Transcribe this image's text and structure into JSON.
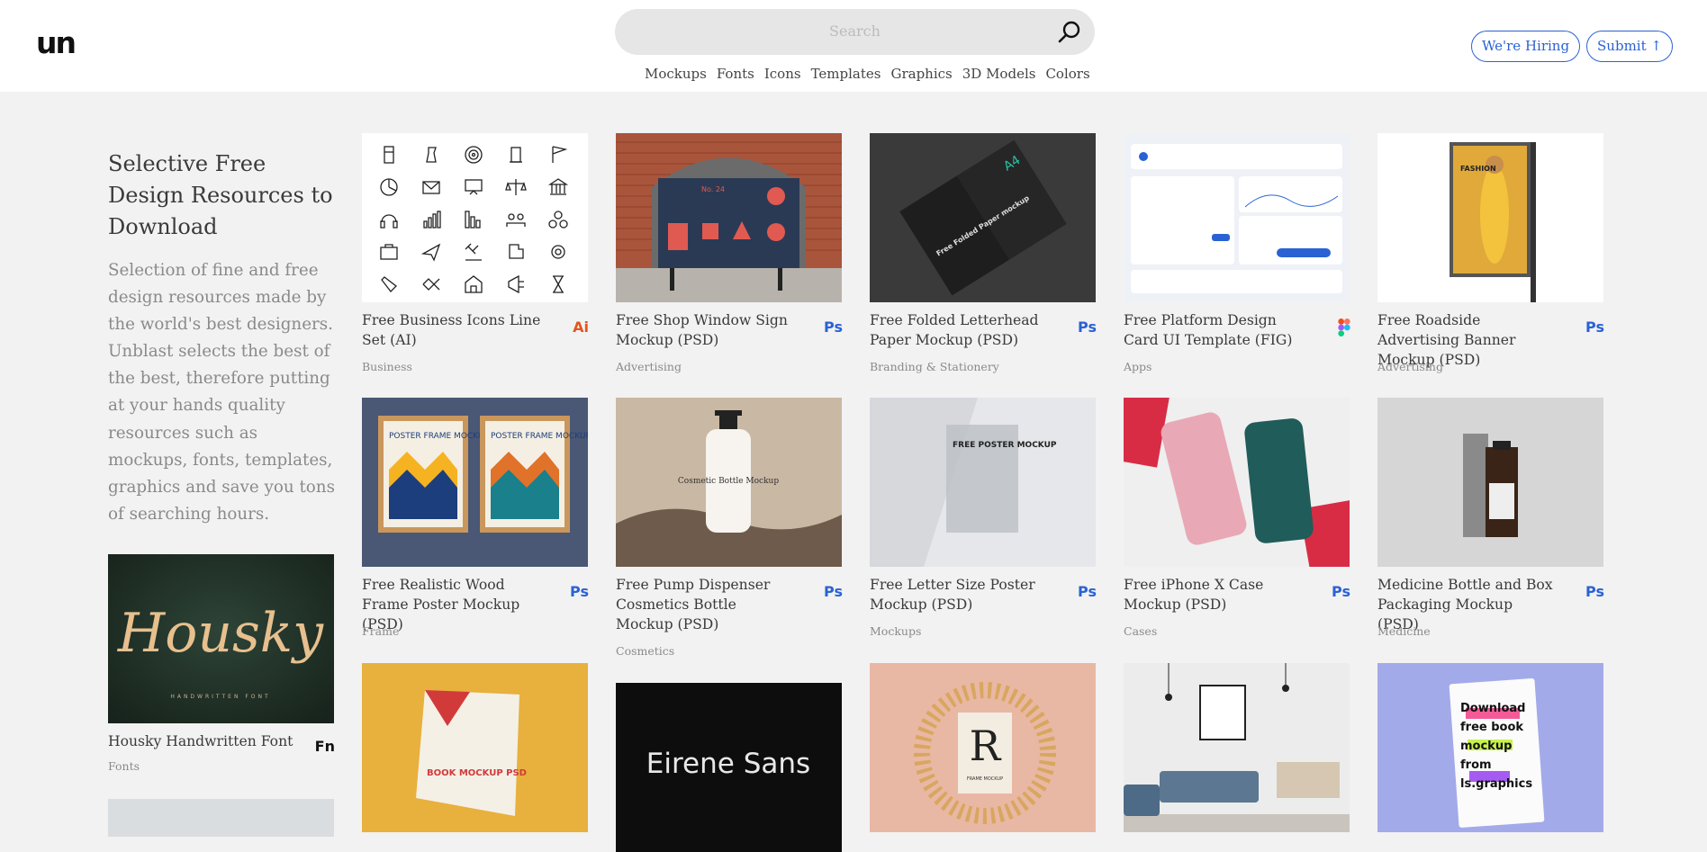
{
  "header": {
    "search_placeholder": "Search",
    "nav": [
      "Mockups",
      "Fonts",
      "Icons",
      "Templates",
      "Graphics",
      "3D Models",
      "Colors"
    ],
    "hiring_label": "We're Hiring",
    "submit_label": "Submit ↑"
  },
  "logo_text": "un",
  "sidebar": {
    "title": "Selective Free Design Resources to Download",
    "description": "Selection of fine and free design resources made by the world's best designers. Unblast selects the best of the best, therefore putting at your hands quality resources such as mockups, fonts, templates, graphics and save you tons of searching hours.",
    "featured": {
      "title": "Housky Handwritten Font",
      "category": "Fonts",
      "badge": "Fn",
      "thumb_text": "Housky",
      "thumb_sub": "HANDWRITTEN FONT"
    }
  },
  "cards": [
    {
      "title": "Free Business Icons Line Set (AI)",
      "category": "Business",
      "badge": "Ai"
    },
    {
      "title": "Free Shop Window Sign Mockup (PSD)",
      "category": "Advertising",
      "badge": "Ps"
    },
    {
      "title": "Free Folded Letterhead Paper Mockup (PSD)",
      "category": "Branding & Stationery",
      "badge": "Ps"
    },
    {
      "title": "Free Platform Design Card UI Template (FIG)",
      "category": "Apps",
      "badge": "figma"
    },
    {
      "title": "Free Roadside Advertising Banner Mockup (PSD)",
      "category": "Advertising",
      "badge": "Ps"
    },
    {
      "title": "Free Realistic Wood Frame Poster Mockup (PSD)",
      "category": "Frame",
      "badge": "Ps"
    },
    {
      "title": "Free Pump Dispenser Cosmetics Bottle Mockup (PSD)",
      "category": "Cosmetics",
      "badge": "Ps"
    },
    {
      "title": "Free Letter Size Poster Mockup (PSD)",
      "category": "Mockups",
      "badge": "Ps"
    },
    {
      "title": "Free iPhone X Case Mockup (PSD)",
      "category": "Cases",
      "badge": "Ps"
    },
    {
      "title": "Medicine Bottle and Box Packaging Mockup (PSD)",
      "category": "Medicine",
      "badge": "Ps"
    }
  ],
  "thumb_text": {
    "poster_frame": "POSTER FRAME MOCKUP",
    "cosmetic": "Cosmetic Bottle Mockup",
    "letter_poster": "FREE POSTER MOCKUP",
    "a4": "A4",
    "folded": "Free Folded Paper mockup",
    "book": "BOOK MOCKUP PSD",
    "eirene": "Eirene Sans",
    "frame_letter": "R",
    "frame_caption": "FRAME MOCKUP",
    "download_book": "Download free book mockup from ls.graphics",
    "fashion": "FASHION",
    "shop_no": "No. 24"
  },
  "colors": {
    "accent": "#2a62d4",
    "ai": "#e2561d",
    "background": "#f2f2f2"
  }
}
